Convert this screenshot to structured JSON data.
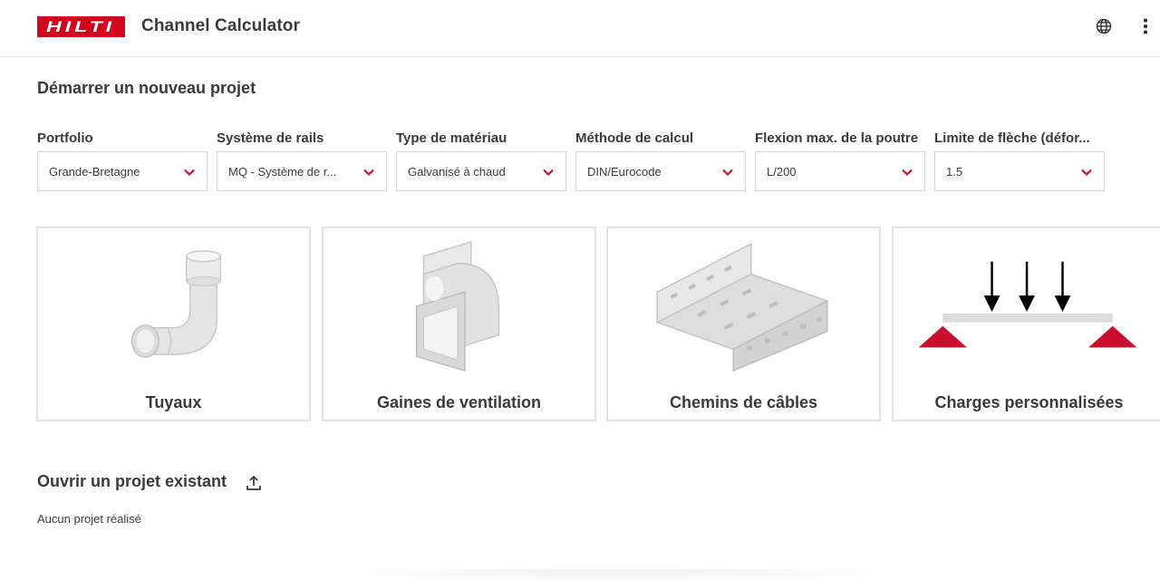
{
  "header": {
    "logo_text": "HILTI",
    "app_title": "Channel Calculator",
    "globe_icon": "globe-icon",
    "menu_icon": "more-vertical-icon"
  },
  "new_project": {
    "title": "Démarrer un nouveau projet",
    "fields": [
      {
        "label": "Portfolio",
        "value": "Grande-Bretagne"
      },
      {
        "label": "Système de rails",
        "value": "MQ - Système de r..."
      },
      {
        "label": "Type de matériau",
        "value": "Galvanisé à chaud"
      },
      {
        "label": "Méthode de calcul",
        "value": "DIN/Eurocode"
      },
      {
        "label": "Flexion max. de la poutre",
        "value": "L/200"
      },
      {
        "label": "Limite de flèche (défor...",
        "value": "1.5"
      }
    ],
    "cards": [
      {
        "label": "Tuyaux",
        "icon": "pipe-elbow-icon"
      },
      {
        "label": "Gaines de ventilation",
        "icon": "ventilation-duct-icon"
      },
      {
        "label": "Chemins de câbles",
        "icon": "cable-tray-icon"
      },
      {
        "label": "Charges personnalisées",
        "icon": "custom-load-icon"
      }
    ]
  },
  "open_project": {
    "title": "Ouvrir un projet existant",
    "upload_icon": "upload-icon",
    "empty_text": "Aucun projet réalisé"
  },
  "colors": {
    "brand_red": "#d2051e",
    "text": "#3a3a3a",
    "border": "#d6d6d6"
  }
}
